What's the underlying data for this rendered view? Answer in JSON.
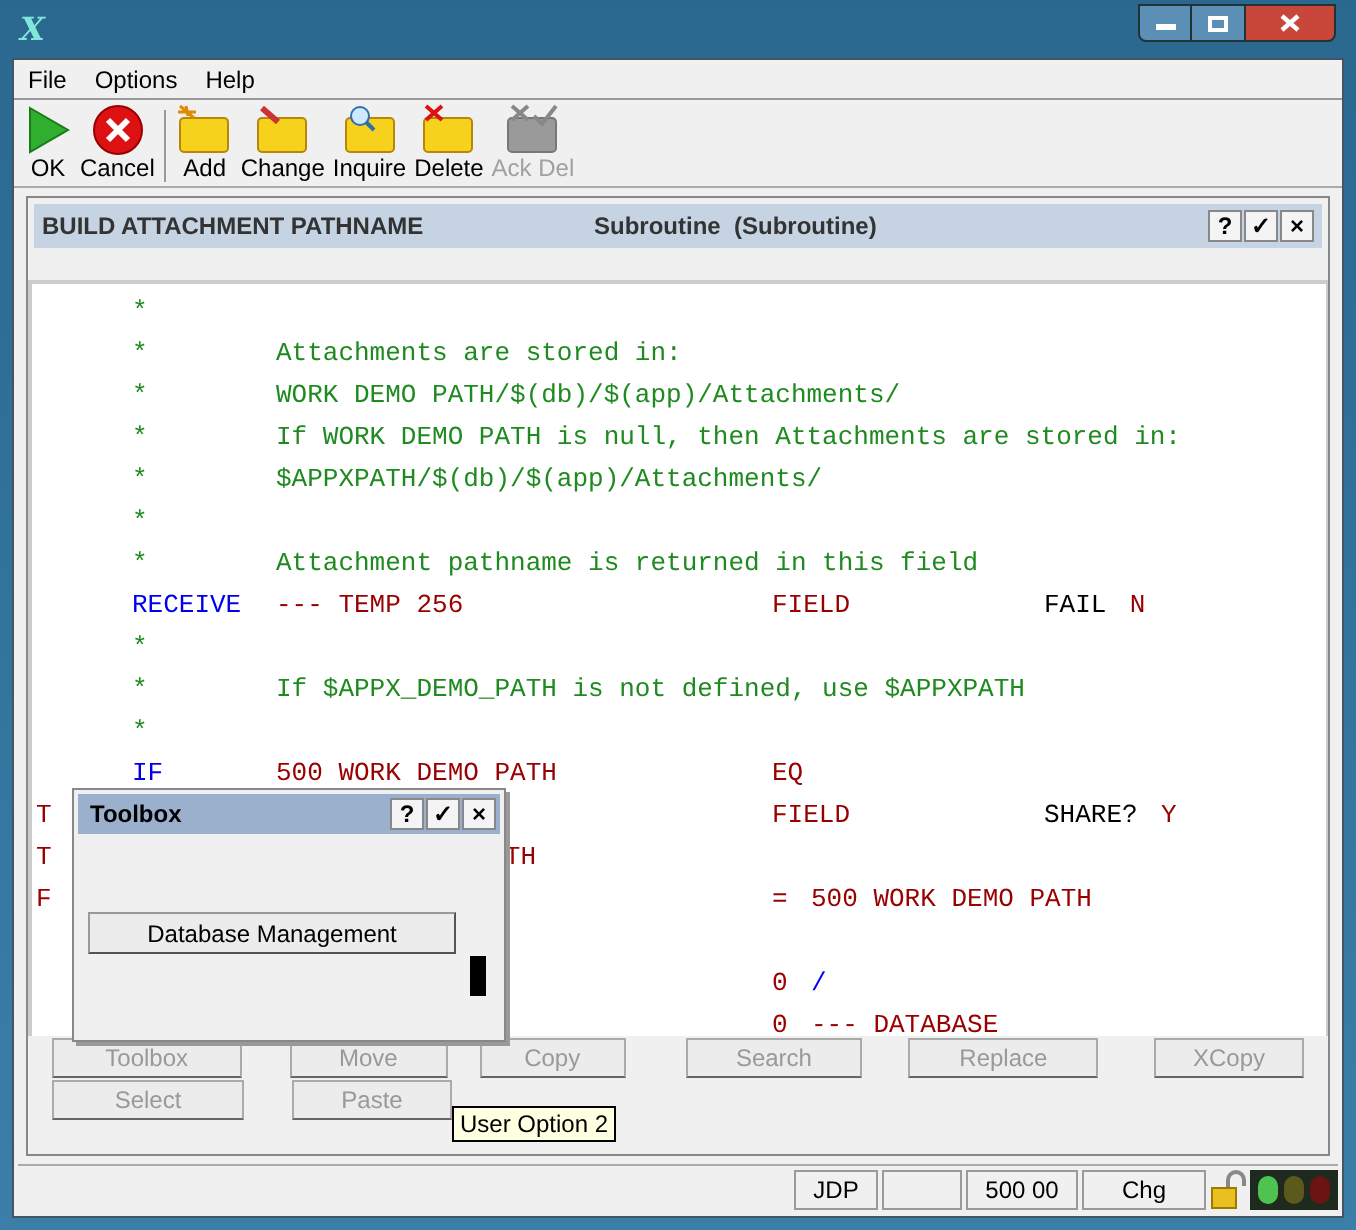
{
  "window": {
    "title_icon": "X"
  },
  "menu": [
    "File",
    "Options",
    "Help"
  ],
  "toolbar": [
    {
      "label": "OK",
      "kind": "ok",
      "disabled": false
    },
    {
      "label": "Cancel",
      "kind": "cancel",
      "disabled": false
    },
    {
      "label": "Add",
      "kind": "add",
      "disabled": false
    },
    {
      "label": "Change",
      "kind": "change",
      "disabled": false
    },
    {
      "label": "Inquire",
      "kind": "inquire",
      "disabled": false
    },
    {
      "label": "Delete",
      "kind": "delete",
      "disabled": false
    },
    {
      "label": "Ack Del",
      "kind": "ackdel",
      "disabled": true
    }
  ],
  "panel": {
    "title": "BUILD ATTACHMENT PATHNAME",
    "subtitle": "Subroutine  (Subroutine)",
    "buttons": [
      "?",
      "✓",
      "×"
    ]
  },
  "code": [
    {
      "verb": [
        {
          "text": "*",
          "kind": "comment"
        }
      ]
    },
    {
      "verb": [
        {
          "text": "*",
          "kind": "comment"
        }
      ],
      "operand": [
        {
          "text": "Attachments are stored in:",
          "kind": "comment"
        }
      ]
    },
    {
      "verb": [
        {
          "text": "*",
          "kind": "comment"
        }
      ],
      "operand": [
        {
          "text": "WORK DEMO PATH/$(db)/$(app)/Attachments/",
          "kind": "comment"
        }
      ]
    },
    {
      "verb": [
        {
          "text": "*",
          "kind": "comment"
        }
      ],
      "operand": [
        {
          "text": "If WORK DEMO PATH is null, then Attachments are stored in:",
          "kind": "comment"
        }
      ]
    },
    {
      "verb": [
        {
          "text": "*",
          "kind": "comment"
        }
      ],
      "operand": [
        {
          "text": "$APPXPATH/$(db)/$(app)/Attachments/",
          "kind": "comment"
        }
      ]
    },
    {
      "verb": [
        {
          "text": "*",
          "kind": "comment"
        }
      ]
    },
    {
      "verb": [
        {
          "text": "*",
          "kind": "comment"
        }
      ],
      "operand": [
        {
          "text": "Attachment pathname is returned in this field",
          "kind": "comment"
        }
      ]
    },
    {
      "verb": [
        {
          "text": "RECEIVE",
          "kind": "keyword"
        }
      ],
      "operand": [
        {
          "text": "--- TEMP 256",
          "kind": "value"
        }
      ],
      "relation": [
        {
          "text": "FIELD",
          "kind": "value"
        }
      ],
      "extra": [
        {
          "text": "FAIL",
          "kind": "label"
        },
        {
          "text": "N",
          "kind": "value"
        }
      ]
    },
    {
      "verb": [
        {
          "text": "*",
          "kind": "comment"
        }
      ]
    },
    {
      "verb": [
        {
          "text": "*",
          "kind": "comment"
        }
      ],
      "operand": [
        {
          "text": "If $APPX_DEMO_PATH is not defined, use $APPXPATH",
          "kind": "comment"
        }
      ]
    },
    {
      "verb": [
        {
          "text": "*",
          "kind": "comment"
        }
      ]
    },
    {
      "verb": [
        {
          "text": "IF",
          "kind": "keyword"
        }
      ],
      "operand": [
        {
          "text": "500 WORK DEMO PATH",
          "kind": "value"
        }
      ],
      "relation": [
        {
          "text": "EQ",
          "kind": "value"
        }
      ]
    },
    {
      "flag": "T",
      "relation": [
        {
          "text": "FIELD",
          "kind": "value"
        }
      ],
      "extra": [
        {
          "text": "SHARE?",
          "kind": "label"
        },
        {
          "text": "Y",
          "kind": "value"
        }
      ]
    },
    {
      "flag": "T",
      "tail": [
        {
          "text": "TH",
          "kind": "value"
        }
      ]
    },
    {
      "flag": "F",
      "relation": [
        {
          "text": "=",
          "kind": "value"
        },
        {
          "text": "500 WORK DEMO PATH",
          "kind": "value"
        }
      ]
    },
    {
      "spaced": true,
      "relation": [
        {
          "text": "0",
          "kind": "value"
        },
        {
          "text": "/",
          "kind": "keyword"
        }
      ]
    },
    {
      "relation": [
        {
          "text": "0",
          "kind": "value"
        },
        {
          "text": "--- DATABASE",
          "kind": "value"
        }
      ]
    }
  ],
  "toolbox": {
    "title": "Toolbox",
    "buttons": [
      "?",
      "✓",
      "×"
    ],
    "action": "Database Management"
  },
  "actions": [
    [
      {
        "label": "Toolbox",
        "disabled": true
      },
      {
        "label": "Move",
        "disabled": true
      },
      {
        "label": "Copy",
        "disabled": true
      },
      {
        "label": "Search",
        "disabled": true
      },
      {
        "label": "Replace",
        "disabled": true
      },
      {
        "label": "XCopy",
        "disabled": true
      }
    ],
    [
      {
        "label": "Select",
        "disabled": true
      },
      {
        "label": "Paste",
        "disabled": true
      }
    ]
  ],
  "tooltip": "User Option 2",
  "status_bar": [
    {
      "kind": "text",
      "text": "JDP"
    },
    {
      "kind": "empty"
    },
    {
      "kind": "text",
      "text": "500 00"
    },
    {
      "kind": "text",
      "text": "Chg"
    }
  ],
  "lock": {
    "locked": false
  }
}
